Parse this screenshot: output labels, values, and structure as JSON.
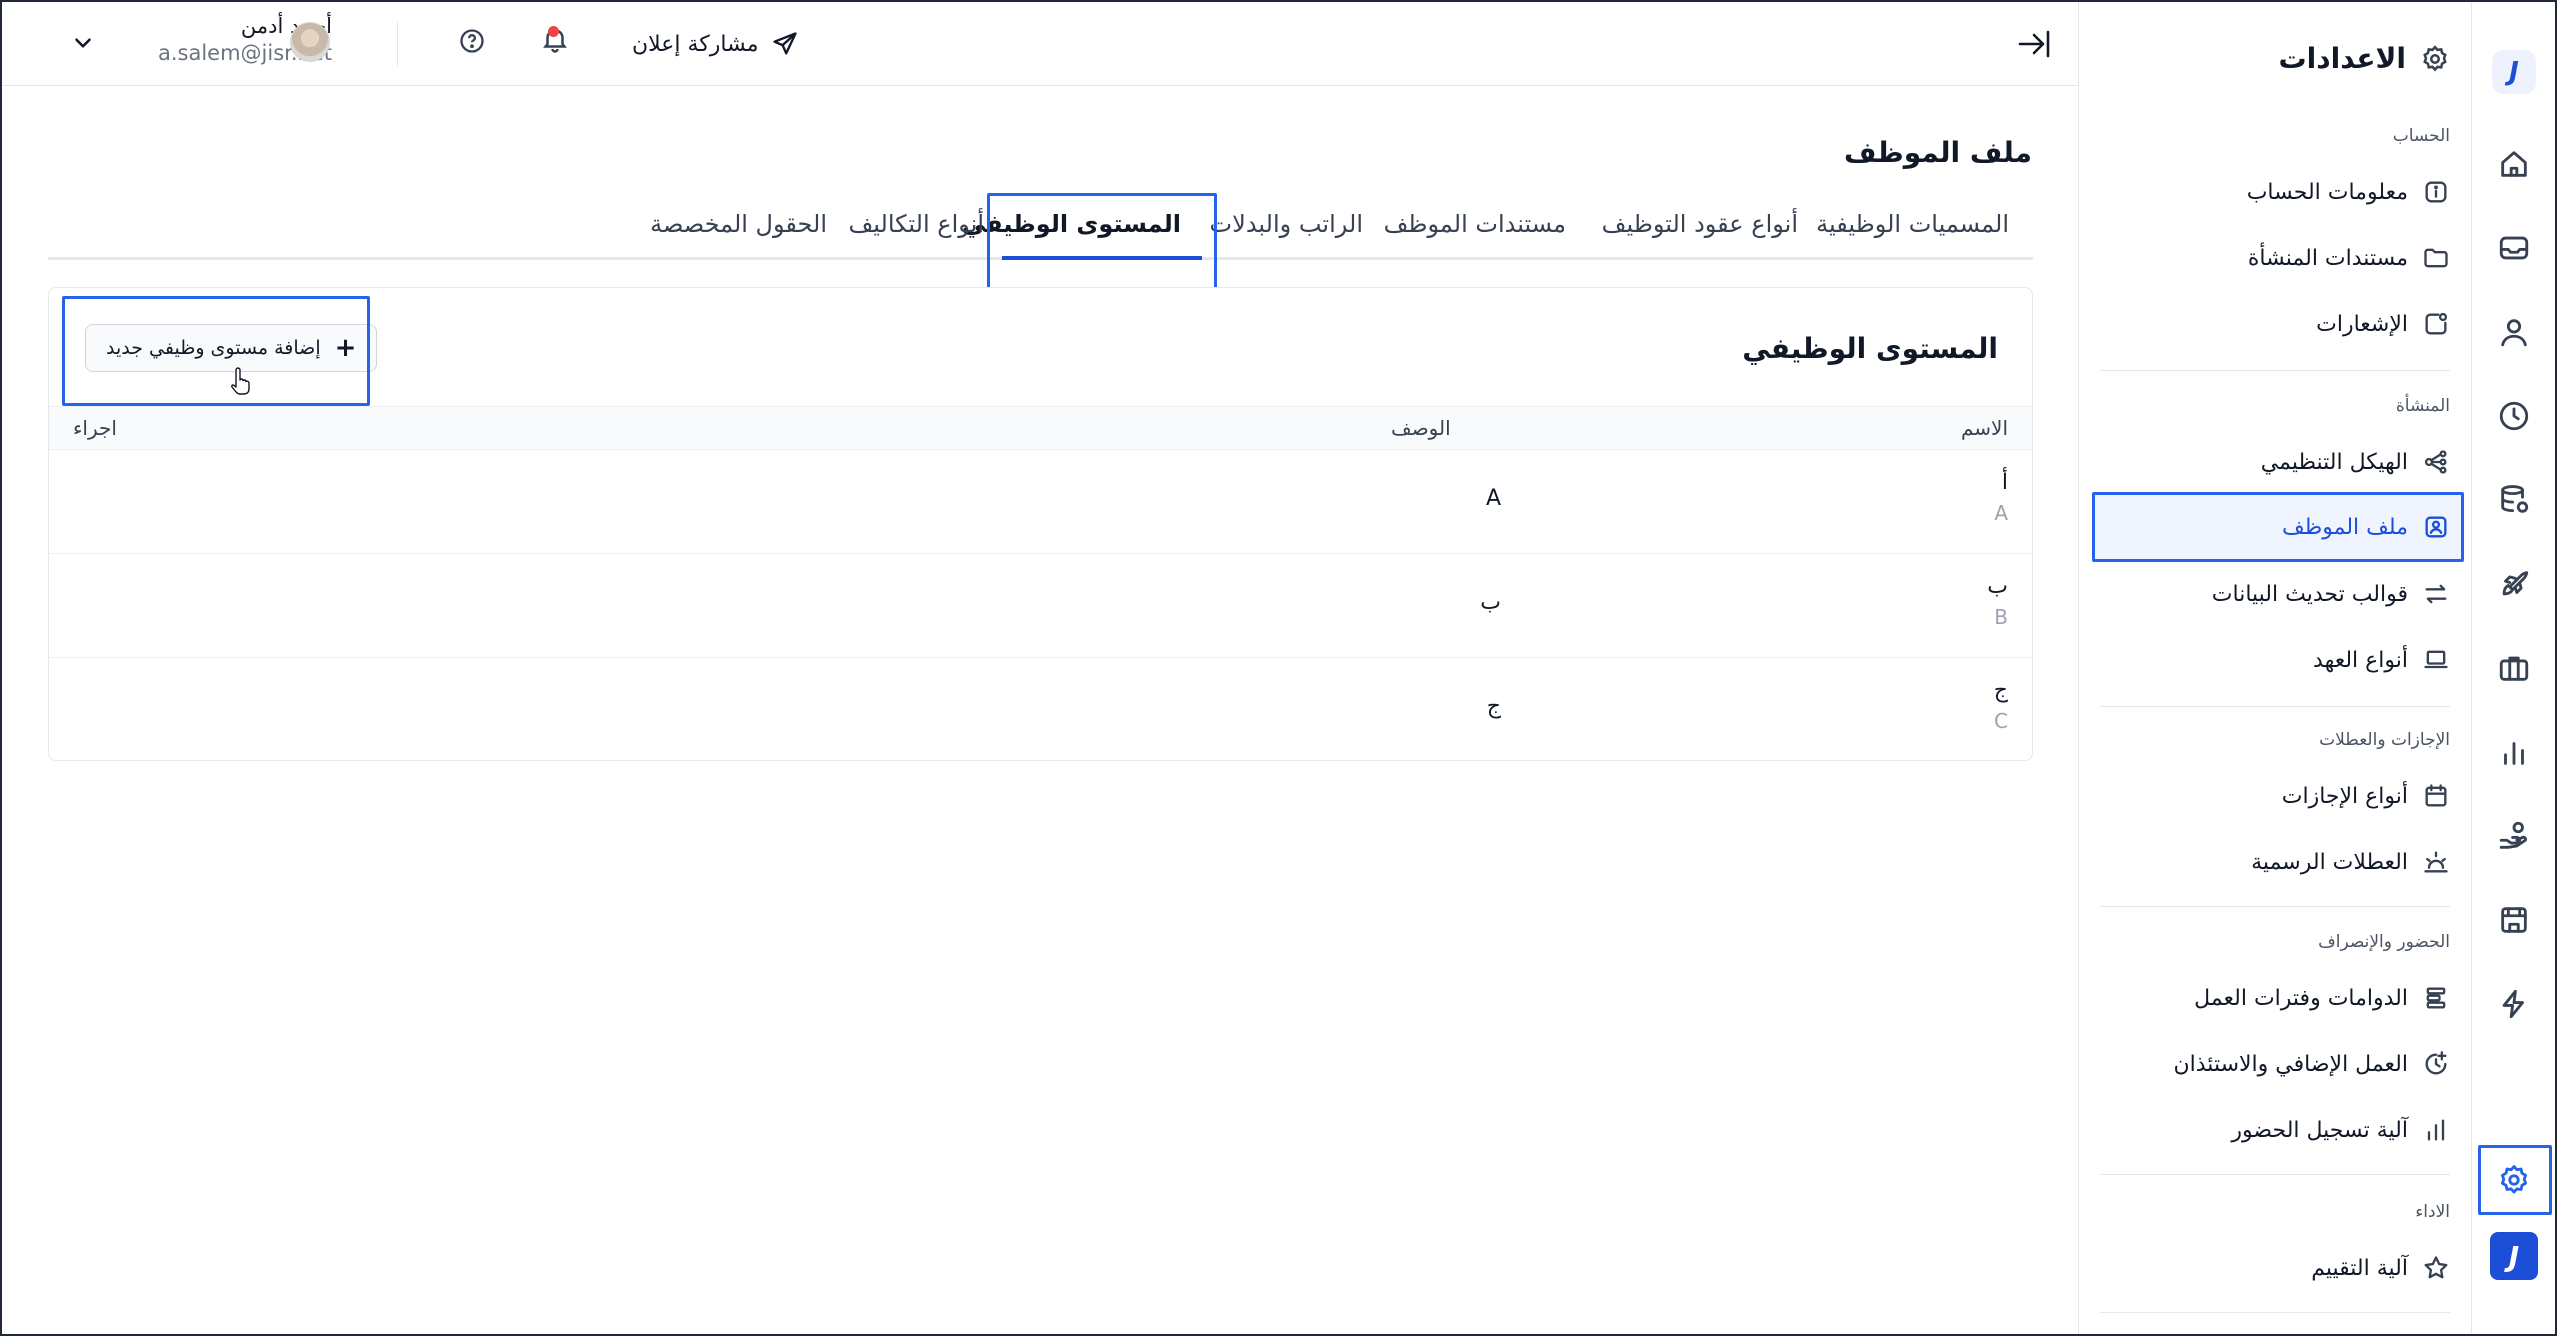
{
  "topbar": {
    "share_label": "مشاركة إعلان",
    "user_name": "أحمد أدمن",
    "user_email": "a.salem@jisr.net"
  },
  "rail": {
    "logo_letter": "J",
    "icons": [
      "home-icon",
      "inbox-icon",
      "user-icon",
      "clock-icon",
      "database-icon",
      "rocket-icon",
      "briefcase-icon",
      "bar-chart-icon",
      "hand-coins-icon",
      "store-icon",
      "lightning-icon",
      "settings-icon"
    ]
  },
  "sidebar": {
    "title": "الاعدادات",
    "sections": [
      {
        "label": "الحساب",
        "items": [
          {
            "label": "معلومات الحساب",
            "icon": "info-icon"
          },
          {
            "label": "مستندات المنشأة",
            "icon": "folder-icon"
          },
          {
            "label": "الإشعارات",
            "icon": "notification-icon"
          }
        ]
      },
      {
        "label": "المنشأة",
        "items": [
          {
            "label": "الهيكل التنظيمي",
            "icon": "org-chart-icon"
          },
          {
            "label": "ملف الموظف",
            "icon": "employee-file-icon",
            "active": true
          },
          {
            "label": "قوالب تحديث البيانات",
            "icon": "swap-icon"
          },
          {
            "label": "أنواع العهد",
            "icon": "laptop-icon"
          }
        ]
      },
      {
        "label": "الإجازات والعطلات",
        "items": [
          {
            "label": "أنواع الإجازات",
            "icon": "calendar-icon"
          },
          {
            "label": "العطلات الرسمية",
            "icon": "sunrise-icon"
          }
        ]
      },
      {
        "label": "الحضور والإنصراف",
        "items": [
          {
            "label": "الدوامات وفترات العمل",
            "icon": "shifts-icon"
          },
          {
            "label": "العمل الإضافي والاستئذان",
            "icon": "clock-plus-icon"
          },
          {
            "label": "آلية تسجيل الحضور",
            "icon": "bars-icon"
          }
        ]
      },
      {
        "label": "الاداء",
        "items": [
          {
            "label": "آلية التقييم",
            "icon": "star-icon"
          }
        ]
      }
    ]
  },
  "main": {
    "page_title": "ملف الموظف",
    "tabs": [
      {
        "label": "المسميات الوظيفية"
      },
      {
        "label": "أنواع عقود التوظيف"
      },
      {
        "label": "مستندات الموظف"
      },
      {
        "label": "الراتب والبدلات"
      },
      {
        "label": "المستوى الوظيفي",
        "active": true
      },
      {
        "label": "أنواع التكاليف"
      },
      {
        "label": "الحقول المخصصة"
      }
    ],
    "card_title": "المستوى الوظيفي",
    "add_button": "إضافة مستوى وظيفي جديد",
    "columns": {
      "name": "الاسم",
      "description": "الوصف",
      "actions": "اجراء"
    },
    "rows": [
      {
        "name_ar": "أ",
        "name_en": "A",
        "description": "A"
      },
      {
        "name_ar": "ب",
        "name_en": "B",
        "description": "ب"
      },
      {
        "name_ar": "ج",
        "name_en": "C",
        "description": "ج"
      }
    ]
  },
  "colors": {
    "accent": "#1d4ed8",
    "highlight_box": "#2563eb",
    "notification_dot": "#ef4444"
  }
}
